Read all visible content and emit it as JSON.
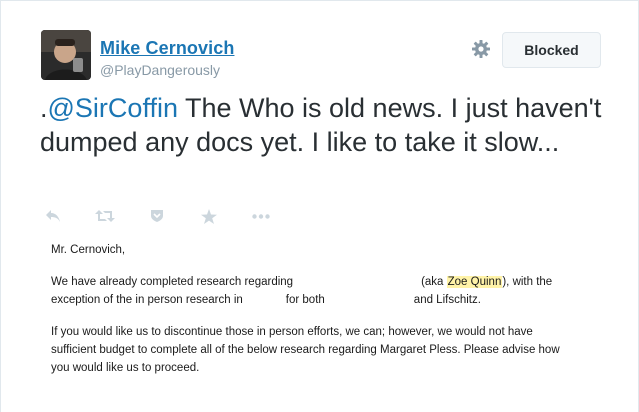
{
  "author": {
    "name": "Mike Cernovich",
    "handle": "@PlayDangerously"
  },
  "header": {
    "blocked_label": "Blocked"
  },
  "tweet": {
    "prefix": ".",
    "mention": "@SirCoffin",
    "text": " The Who is old news. I just haven't dumped any docs yet. I like to take it slow..."
  },
  "actions": {
    "icons": [
      "reply-icon",
      "retweet-icon",
      "favorite-icon",
      "star-icon",
      "more-icon"
    ]
  },
  "letter": {
    "salutation": "Mr. Cernovich,",
    "p1_a": "We have already completed research regarding",
    "p1_b": "(aka",
    "p1_highlight": "Zoe Quinn",
    "p1_c": "), with the",
    "p1_line2_a": "exception of the in person research in",
    "p1_line2_b": "for both",
    "p1_line2_c": "and Lifschitz.",
    "p2_line1": "If you would like us to discontinue those in person efforts, we can; however, we would not have",
    "p2_line2": "sufficient budget to complete all of the below research regarding Margaret Pless.  Please advise how",
    "p2_line3": "you would like us to proceed."
  },
  "colors": {
    "link": "#1b76b4",
    "muted": "#8899a6",
    "highlight": "#fff3a8"
  }
}
